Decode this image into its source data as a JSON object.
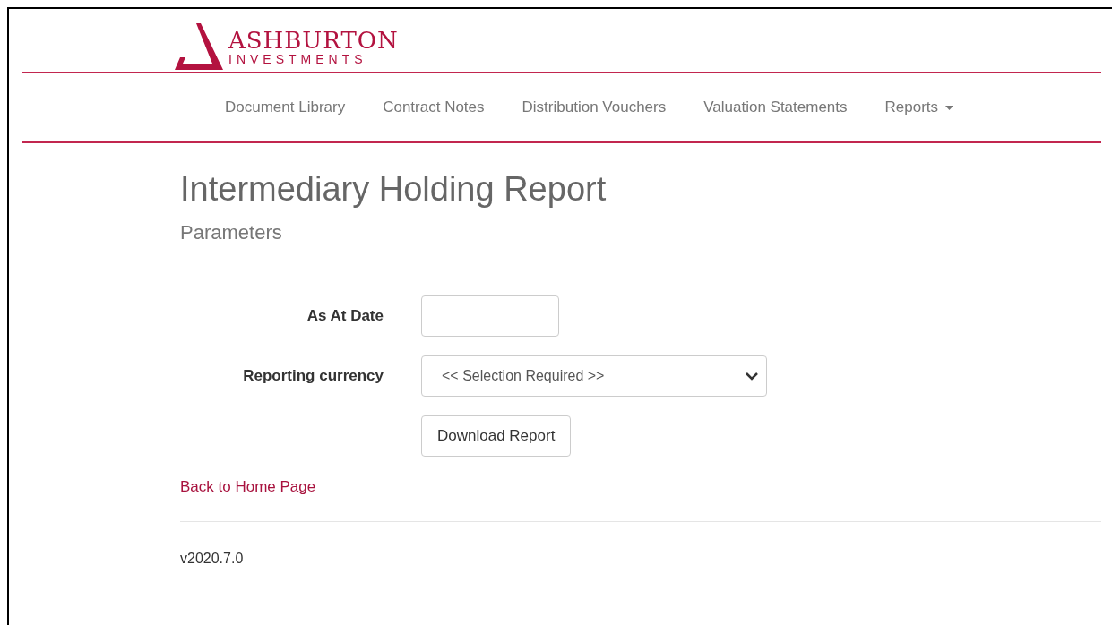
{
  "logo": {
    "name": "ASHBURTON",
    "tagline": "INVESTMENTS"
  },
  "nav": [
    {
      "label": "Document Library",
      "kind": "link"
    },
    {
      "label": "Contract Notes",
      "kind": "link"
    },
    {
      "label": "Distribution Vouchers",
      "kind": "link"
    },
    {
      "label": "Valuation Statements",
      "kind": "link"
    },
    {
      "label": "Reports",
      "kind": "dropdown"
    }
  ],
  "page": {
    "title": "Intermediary Holding Report",
    "subtitle": "Parameters"
  },
  "form": {
    "fields": [
      {
        "label": "As At Date",
        "kind": "text"
      },
      {
        "label": "Reporting currency",
        "kind": "select",
        "value": "<< Selection Required >>"
      }
    ],
    "button": "Download Report"
  },
  "back_link": "Back to Home Page",
  "footer": {
    "version": "v2020.7.0"
  }
}
